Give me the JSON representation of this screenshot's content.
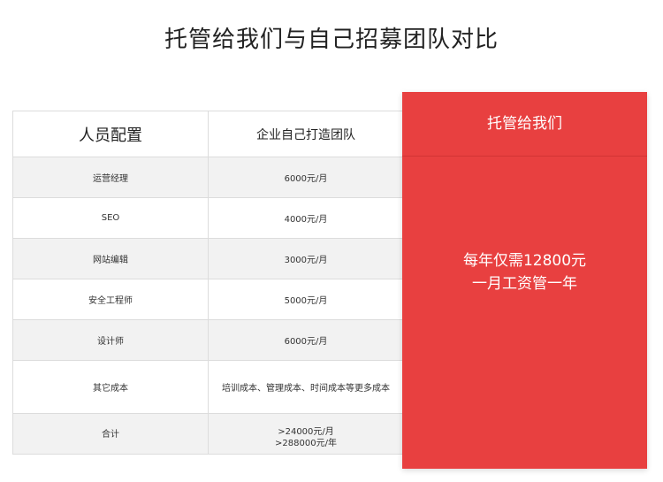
{
  "title": "托管给我们与自己招募团队对比",
  "table": {
    "header": {
      "col1": "人员配置",
      "col2": "企业自己打造团队"
    },
    "rows": [
      {
        "role": "运营经理",
        "cost": "6000元/月"
      },
      {
        "role": "SEO",
        "cost": "4000元/月"
      },
      {
        "role": "网站编辑",
        "cost": "3000元/月"
      },
      {
        "role": "安全工程师",
        "cost": "5000元/月"
      },
      {
        "role": "设计师",
        "cost": "6000元/月"
      },
      {
        "role": "其它成本",
        "cost": "培训成本、管理成本、时间成本等更多成本"
      }
    ],
    "total": {
      "label": "合计",
      "monthly": ">24000元/月",
      "yearly": ">288000元/年"
    }
  },
  "offer": {
    "header": "托管给我们",
    "line1": "每年仅需12800元",
    "line2": "一月工资管一年"
  },
  "colors": {
    "accent": "#e84040",
    "row_stripe": "#f2f2f2",
    "border": "#dcdcdc"
  }
}
